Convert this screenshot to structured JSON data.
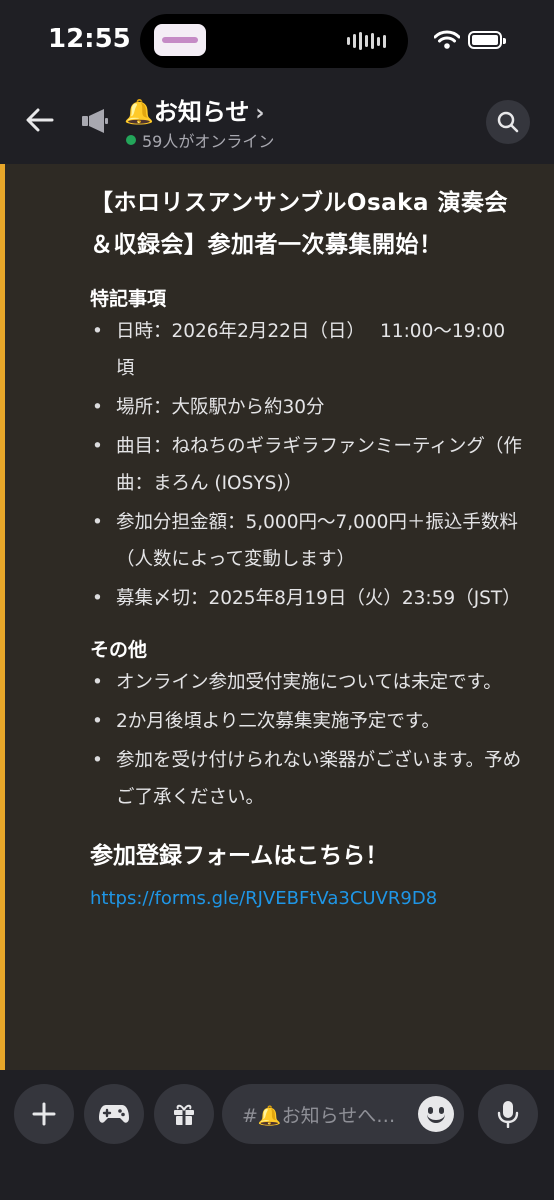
{
  "status_bar": {
    "time": "12:55"
  },
  "header": {
    "channel_name": "🔔お知らせ",
    "chevron": "›",
    "online_status": "59人がオンライン"
  },
  "message": {
    "headline": "【ホロリスアンサンブルOsaka 演奏会＆収録会】参加者一次募集開始！",
    "section1_title": "特記事項",
    "section1_items": [
      "日時：2026年2月22日（日）　 11:00〜19:00　頃",
      "場所：大阪駅から約30分",
      "曲目：ねねちのギラギラファンミーティング（作曲：まろん (IOSYS)）",
      "参加分担金額：5,000円〜7,000円＋振込手数料（人数によって変動します）",
      "募集〆切：2025年8月19日（火）23:59（JST）"
    ],
    "section2_title": "その他",
    "section2_items": [
      "オンライン参加受付実施については未定です。",
      "2か月後頃より二次募集実施予定です。",
      "参加を受け付けられない楽器がございます。予めご了承ください。"
    ],
    "cta": "参加登録フォームはこちら！",
    "link": "https://forms.gle/RJVEBFtVa3CUVR9D8"
  },
  "composer": {
    "placeholder": "#🔔お知らせへ…"
  },
  "icons": {
    "back": "arrow-left-icon",
    "channel": "megaphone-icon",
    "search": "search-icon",
    "plus": "plus-icon",
    "gamepad": "gamepad-icon",
    "gift": "gift-icon",
    "emoji": "emoji-icon",
    "mic": "microphone-icon"
  },
  "colors": {
    "accent_bar": "#e8a72a",
    "online": "#23a55a",
    "link": "#1f96e6",
    "message_bg": "#2e2a24"
  }
}
